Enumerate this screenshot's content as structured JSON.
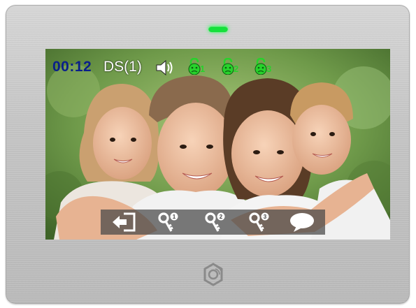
{
  "device": {
    "led_color": "#16e03c",
    "brand_icon": "gear-logo-icon"
  },
  "osd": {
    "time": "00:12",
    "source": "DS(1)",
    "speaker_icon": "speaker-icon",
    "locks": [
      {
        "icon": "lock-icon",
        "number": "1",
        "color": "#27d22b"
      },
      {
        "icon": "lock-icon",
        "number": "2",
        "color": "#27d22b"
      },
      {
        "icon": "lock-icon",
        "number": "3",
        "color": "#27d22b"
      }
    ]
  },
  "toolbar": {
    "buttons": [
      {
        "icon": "exit-icon",
        "label": ""
      },
      {
        "icon": "key-1-icon",
        "badge": "1"
      },
      {
        "icon": "key-2-icon",
        "badge": "2"
      },
      {
        "icon": "key-3-icon",
        "badge": "3"
      },
      {
        "icon": "intercom-chat-icon",
        "label": ""
      }
    ]
  }
}
